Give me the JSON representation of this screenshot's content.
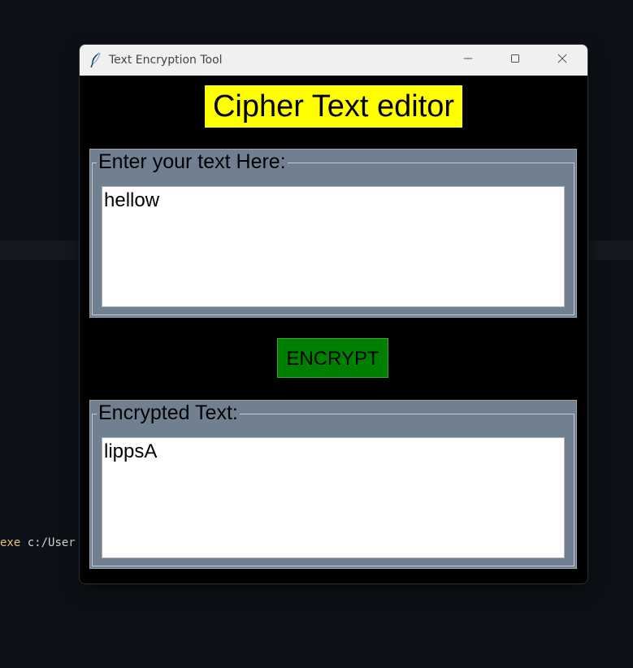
{
  "background": {
    "terminal_keyword": "exe",
    "terminal_text": " c:/User"
  },
  "window": {
    "title": "Text Encryption Tool",
    "icon": "feather-icon",
    "controls": [
      "minimize-icon",
      "maximize-icon",
      "close-icon"
    ]
  },
  "app": {
    "heading": "Cipher Text editor",
    "input_group_label": "Enter your text Here:",
    "input_value": "hellow",
    "encrypt_button_label": "ENCRYPT",
    "output_group_label": "Encrypted Text:",
    "output_value": "lippsA"
  },
  "colors": {
    "heading_bg": "#ffff00",
    "group_bg": "#708090",
    "button_bg": "#008000",
    "window_bg": "#000000"
  }
}
